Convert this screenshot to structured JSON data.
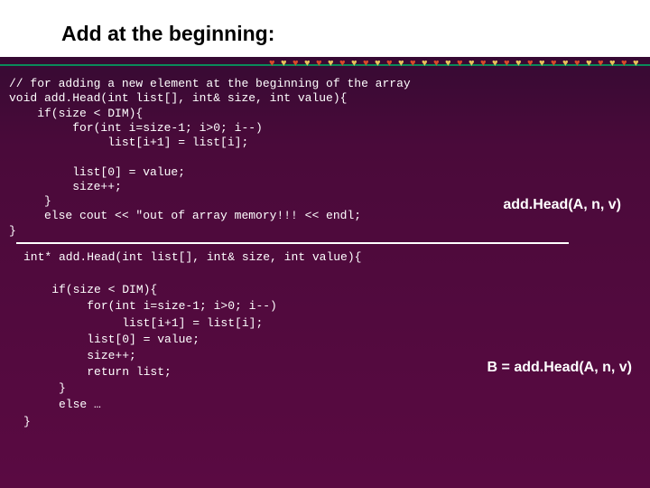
{
  "title": "Add at the beginning:",
  "code_block_1": "// for adding a new element at the beginning of the array\nvoid add.Head(int list[], int& size, int value){\n    if(size < DIM){\n         for(int i=size-1; i>0; i--)\n              list[i+1] = list[i];\n\n         list[0] = value;\n         size++;\n     }\n     else cout << \"out of array memory!!! << endl;\n}",
  "callout_1": "add.Head(A, n, v)",
  "code_block_2": "int* add.Head(int list[], int& size, int value){\n\n    if(size < DIM){\n         for(int i=size-1; i>0; i--)\n              list[i+1] = list[i];\n         list[0] = value;\n         size++;\n         return list;\n     }\n     else …\n}",
  "callout_2": "B = add.Head(A, n, v)",
  "decor": {
    "heart_count": 32
  }
}
